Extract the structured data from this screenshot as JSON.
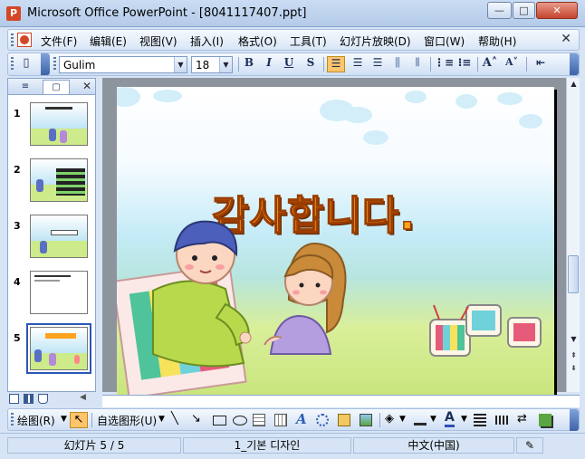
{
  "window": {
    "title": "Microsoft Office PowerPoint - [8041117407.ppt]",
    "app_icon": "powerpoint-icon",
    "controls": {
      "minimize": "—",
      "maximize": "□",
      "close": "✕"
    }
  },
  "menu": {
    "items": [
      {
        "label": "文件(F)"
      },
      {
        "label": "编辑(E)"
      },
      {
        "label": "视图(V)"
      },
      {
        "label": "插入(I)"
      },
      {
        "label": "格式(O)"
      },
      {
        "label": "工具(T)"
      },
      {
        "label": "幻灯片放映(D)"
      },
      {
        "label": "窗口(W)"
      },
      {
        "label": "帮助(H)"
      }
    ],
    "close_glyph": "✕"
  },
  "format_toolbar": {
    "font_name": "Gulim",
    "font_size": "18",
    "bold": "B",
    "italic": "I",
    "underline": "U",
    "shadow": "S",
    "align_left_active": true
  },
  "left_panel": {
    "tab_outline": "≡",
    "tab_slides": "▢",
    "close": "✕",
    "slides": [
      {
        "num": "1"
      },
      {
        "num": "2"
      },
      {
        "num": "3"
      },
      {
        "num": "4"
      },
      {
        "num": "5",
        "selected": true
      }
    ]
  },
  "slide": {
    "title_text": "감사합니다."
  },
  "draw_toolbar": {
    "draw_label": "绘图(R)",
    "autoshapes_label": "自选图形(U)"
  },
  "status": {
    "slide_indicator": "幻灯片 5 / 5",
    "design": "1_기본 디자인",
    "language": "中文(中国)"
  },
  "colors": {
    "title_fill": "#ffa21c",
    "title_outline": "#9b3d00",
    "accent_active": "#ffc56a"
  }
}
